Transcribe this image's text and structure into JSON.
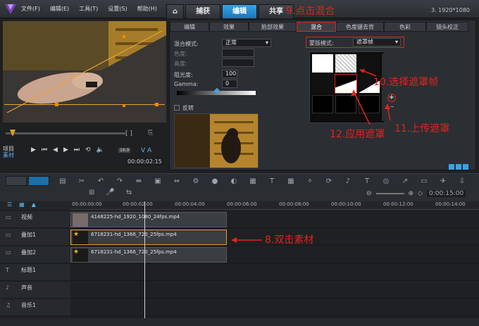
{
  "menu": [
    "文件(F)",
    "编辑(E)",
    "工具(T)",
    "设置(S)",
    "帮助(H)"
  ],
  "tabs": {
    "capture": "捕获",
    "edit": "编辑",
    "share": "共享"
  },
  "resolution": "3. 1920*1080",
  "annotations": {
    "step9": "9.点击混合",
    "step10": "10.选择遮罩帧",
    "step11": "11.上传遮罩",
    "step12": "12.应用遮罩",
    "step8": "8.双击素材"
  },
  "player": {
    "project_label": "项目",
    "clip_label": "素材",
    "timecode": "00:00:02:15",
    "speed_tag": "16:9"
  },
  "panel_tabs": [
    "编辑",
    "效果",
    "脸部效果",
    "混合",
    "色度键去背",
    "色彩",
    "镜头校正"
  ],
  "blend": {
    "mode_label": "混合模式:",
    "mode_value": "正常",
    "hue_label": "色度:",
    "saturation_label": "高度:",
    "opacity_label": "阻光度:",
    "opacity_value": "100",
    "gamma_label": "Gamma:",
    "gamma_value": "0",
    "invert_label": "反转",
    "mask_mode_label": "蒙版模式:",
    "mask_mode_value": "遮罩帧"
  },
  "ruler": [
    "00:00:00:00",
    "00:00:02:00",
    "00:00:04:00",
    "00:00:06:00",
    "00:00:08:00",
    "00:00:10:00",
    "00:00:12:00",
    "00:00:14:00"
  ],
  "zoom_time": "0:00:15:00",
  "tracks": [
    {
      "name": "视频",
      "clip": "4148225-hd_1920_1080_24fps.mp4"
    },
    {
      "name": "叠加1",
      "clip": "6718231-hd_1366_720_25fps.mp4"
    },
    {
      "name": "叠加2",
      "clip": "6718231-hd_1366_720_25fps.mp4"
    },
    {
      "name": "标题1",
      "clip": ""
    },
    {
      "name": "声音",
      "clip": ""
    },
    {
      "name": "音乐1",
      "clip": ""
    }
  ],
  "colors": {
    "accent": "#2a8fd6",
    "annotation": "#e0251c"
  }
}
